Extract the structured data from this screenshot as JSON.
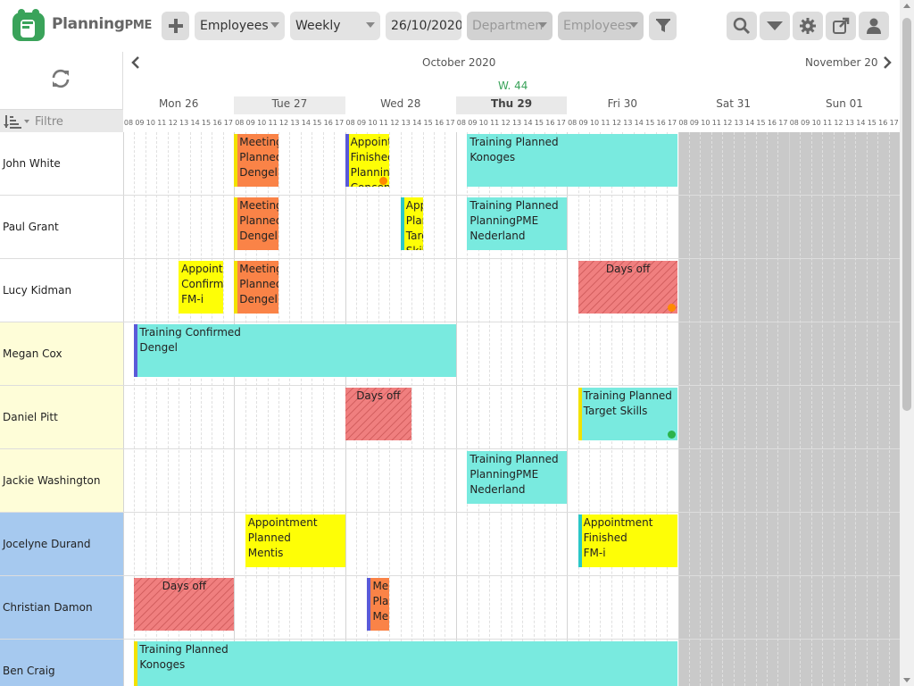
{
  "app": {
    "name": "Planning",
    "name_suffix": "PME",
    "logo_icon": "planningpme-logo-icon"
  },
  "toolbar": {
    "add_icon": "plus-icon",
    "resource_select": "Employees",
    "view_select": "Weekly",
    "date_value": "26/10/2020",
    "department_select": "Departmen",
    "employees_filter_select": "Employees",
    "filter_icon": "funnel-icon",
    "search_icon": "search-icon",
    "dropdown_icon": "chevron-down-icon",
    "settings_icon": "gear-icon",
    "export_icon": "export-icon",
    "user_icon": "user-icon"
  },
  "left_header": {
    "refresh_icon": "refresh-icon",
    "sort_icon": "sort-icon",
    "filter_placeholder": "Filtre"
  },
  "calendar": {
    "month_current": "October 2020",
    "month_next": "November 20",
    "week": "W. 44",
    "days": [
      {
        "label": "Mon 26"
      },
      {
        "label": "Tue 27"
      },
      {
        "label": "Wed 28"
      },
      {
        "label": "Thu 29",
        "today": true
      },
      {
        "label": "Fri 30"
      },
      {
        "label": "Sat 31",
        "weekend": true
      },
      {
        "label": "Sun 01",
        "weekend": true
      }
    ],
    "hours": [
      "08",
      "09",
      "10",
      "11",
      "12",
      "13",
      "14",
      "15",
      "16",
      "17"
    ]
  },
  "colors": {
    "training": "#79eadf",
    "appointment": "#fefe06",
    "meeting": "#fa8347",
    "days_off": "#f07f7f",
    "group_yellow": "#fefdd8",
    "group_blue": "#a6c9ef",
    "week_label": "#3aa35a"
  },
  "resources": [
    {
      "name": "John White",
      "group": "white"
    },
    {
      "name": "Paul Grant",
      "group": "white"
    },
    {
      "name": "Lucy Kidman",
      "group": "white"
    },
    {
      "name": "Megan Cox",
      "group": "yellow"
    },
    {
      "name": "Daniel Pitt",
      "group": "yellow"
    },
    {
      "name": "Jackie Washington",
      "group": "yellow"
    },
    {
      "name": "Jocelyne Durand",
      "group": "blue"
    },
    {
      "name": "Christian Damon",
      "group": "blue"
    },
    {
      "name": "Ben Craig",
      "group": "blue"
    }
  ],
  "tasks": [
    {
      "row": 0,
      "day": 1,
      "start": 8,
      "end": 12,
      "kind": "meeting",
      "bar": "#f2e200",
      "lines": [
        "Meeting",
        "Planned",
        "Dengel"
      ]
    },
    {
      "row": 0,
      "day": 2,
      "start": 8,
      "end": 12,
      "kind": "appointment",
      "bar": "#5a5ad8",
      "lines": [
        "Appointment",
        "Finished",
        "Planning",
        "Concept"
      ],
      "badge": "#ff8a00"
    },
    {
      "row": 0,
      "day": 3,
      "start": 9,
      "end": 18,
      "kind": "training",
      "lines": [
        "Training Planned",
        "Konoges"
      ],
      "span_to": 4
    },
    {
      "row": 1,
      "day": 1,
      "start": 8,
      "end": 12,
      "kind": "meeting",
      "bar": "#f2e200",
      "lines": [
        "Meeting",
        "Planned",
        "Dengel"
      ]
    },
    {
      "row": 1,
      "day": 2,
      "start": 13,
      "end": 15,
      "kind": "appointment",
      "bar": "#2bc7c7",
      "lines": [
        "Appointment",
        "Planned",
        "Target",
        "Skills"
      ]
    },
    {
      "row": 1,
      "day": 3,
      "start": 9,
      "end": 18,
      "kind": "training",
      "lines": [
        "Training Planned",
        "PlanningPME",
        "Nederland"
      ]
    },
    {
      "row": 2,
      "day": 0,
      "start": 13,
      "end": 17,
      "kind": "appointment",
      "lines": [
        "Appointment",
        "Confirmed",
        "FM-i"
      ]
    },
    {
      "row": 2,
      "day": 1,
      "start": 8,
      "end": 12,
      "kind": "meeting",
      "bar": "#f2e200",
      "lines": [
        "Meeting",
        "Planned",
        "Dengel"
      ]
    },
    {
      "row": 2,
      "day": 4,
      "start": 9,
      "end": 18,
      "kind": "daysoff",
      "lines": [
        "Days off"
      ],
      "badge": "#ff8a00"
    },
    {
      "row": 3,
      "day": 0,
      "start": 9,
      "end": 18,
      "kind": "training",
      "bar": "#5a5ad8",
      "lines": [
        "Training Confirmed",
        "Dengel"
      ],
      "span_to": 2
    },
    {
      "row": 4,
      "day": 2,
      "start": 8,
      "end": 14,
      "kind": "daysoff",
      "lines": [
        "Days off"
      ]
    },
    {
      "row": 4,
      "day": 4,
      "start": 9,
      "end": 18,
      "kind": "training",
      "bar": "#f2e200",
      "lines": [
        "Training Planned",
        "Target Skills"
      ],
      "badge": "#2bb34a"
    },
    {
      "row": 5,
      "day": 3,
      "start": 9,
      "end": 18,
      "kind": "training",
      "lines": [
        "Training Planned",
        "PlanningPME",
        "Nederland"
      ]
    },
    {
      "row": 6,
      "day": 1,
      "start": 9,
      "end": 18,
      "kind": "appointment",
      "lines": [
        "Appointment",
        "Planned",
        "Mentis"
      ]
    },
    {
      "row": 6,
      "day": 4,
      "start": 9,
      "end": 18,
      "kind": "appointment",
      "bar": "#2bc7c7",
      "lines": [
        "Appointment",
        "Finished",
        "FM-i"
      ]
    },
    {
      "row": 7,
      "day": 0,
      "start": 9,
      "end": 18,
      "kind": "daysoff",
      "lines": [
        "Days off"
      ]
    },
    {
      "row": 7,
      "day": 2,
      "start": 10,
      "end": 12,
      "kind": "meeting",
      "bar": "#5a5ad8",
      "lines": [
        "Meeting",
        "Planned",
        "Mentis"
      ]
    },
    {
      "row": 8,
      "day": 0,
      "start": 9,
      "end": 18,
      "kind": "training",
      "bar": "#f2e200",
      "lines": [
        "Training Planned",
        "Konoges"
      ],
      "span_to": 4
    }
  ]
}
